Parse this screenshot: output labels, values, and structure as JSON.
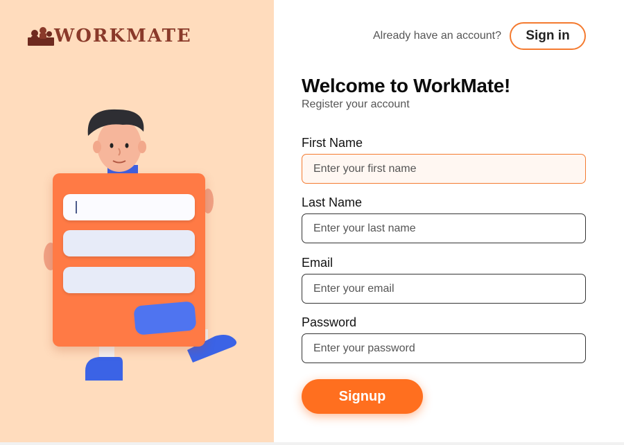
{
  "brand": {
    "name": "WORKMATE",
    "color": "#8a3a2a"
  },
  "header": {
    "signin_prompt": "Already have an account?",
    "signin_label": "Sign in"
  },
  "main": {
    "title": "Welcome to WorkMate!",
    "subtitle": "Register your account",
    "fields": [
      {
        "label": "First Name",
        "placeholder": "Enter your first name",
        "value": ""
      },
      {
        "label": "Last Name",
        "placeholder": "Enter your last name",
        "value": ""
      },
      {
        "label": "Email",
        "placeholder": "Enter your email",
        "value": ""
      },
      {
        "label": "Password",
        "placeholder": "Enter your password",
        "value": ""
      }
    ],
    "submit_label": "Signup"
  },
  "colors": {
    "accent": "#ff6f1f",
    "left_panel": "#ffdcbd",
    "card": "#ff7a45",
    "card_button": "#4f74f0"
  },
  "icons": {
    "logo": "people-logo-icon",
    "illustration": "person-holding-form-illustration"
  }
}
